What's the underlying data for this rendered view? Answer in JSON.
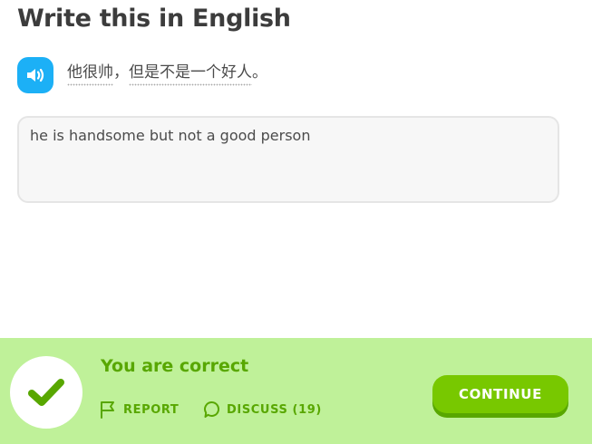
{
  "header": {
    "title": "Write this in English"
  },
  "prompt": {
    "speaker_icon": "speaker-icon",
    "segment_1": "他很帅",
    "separator": "，",
    "segment_2": "但是不是一个好人",
    "end": "。"
  },
  "answer": {
    "value": "he is handsome but not a good person"
  },
  "feedback": {
    "status": "You are correct",
    "check_icon": "checkmark-icon",
    "report_icon": "flag-icon",
    "report_label": "REPORT",
    "discuss_icon": "comment-icon",
    "discuss_label": "DISCUSS (19)",
    "continue_label": "CONTINUE"
  },
  "colors": {
    "speaker": "#1cb0f6",
    "footer_bg": "#bff199",
    "accent_green": "#58a700",
    "button_green": "#78c800"
  }
}
